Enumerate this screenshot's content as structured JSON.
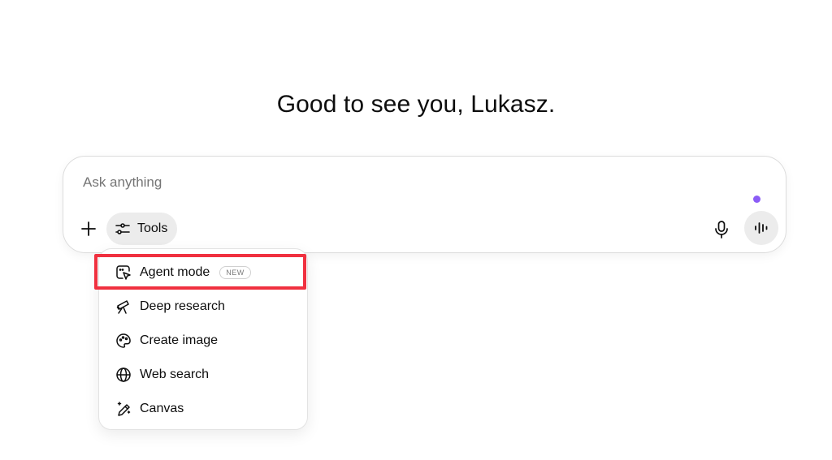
{
  "greeting": "Good to see you, Lukasz.",
  "composer": {
    "placeholder": "Ask anything",
    "tools_label": "Tools",
    "status_dot_color": "#8b5cf6"
  },
  "menu": {
    "items": [
      {
        "label": "Agent mode",
        "icon": "agent-cursor-icon",
        "badge": "NEW"
      },
      {
        "label": "Deep research",
        "icon": "telescope-icon"
      },
      {
        "label": "Create image",
        "icon": "palette-icon"
      },
      {
        "label": "Web search",
        "icon": "globe-icon"
      },
      {
        "label": "Canvas",
        "icon": "magic-pen-icon"
      }
    ]
  },
  "annotation": {
    "color": "#f0303f",
    "target": "Agent mode"
  }
}
